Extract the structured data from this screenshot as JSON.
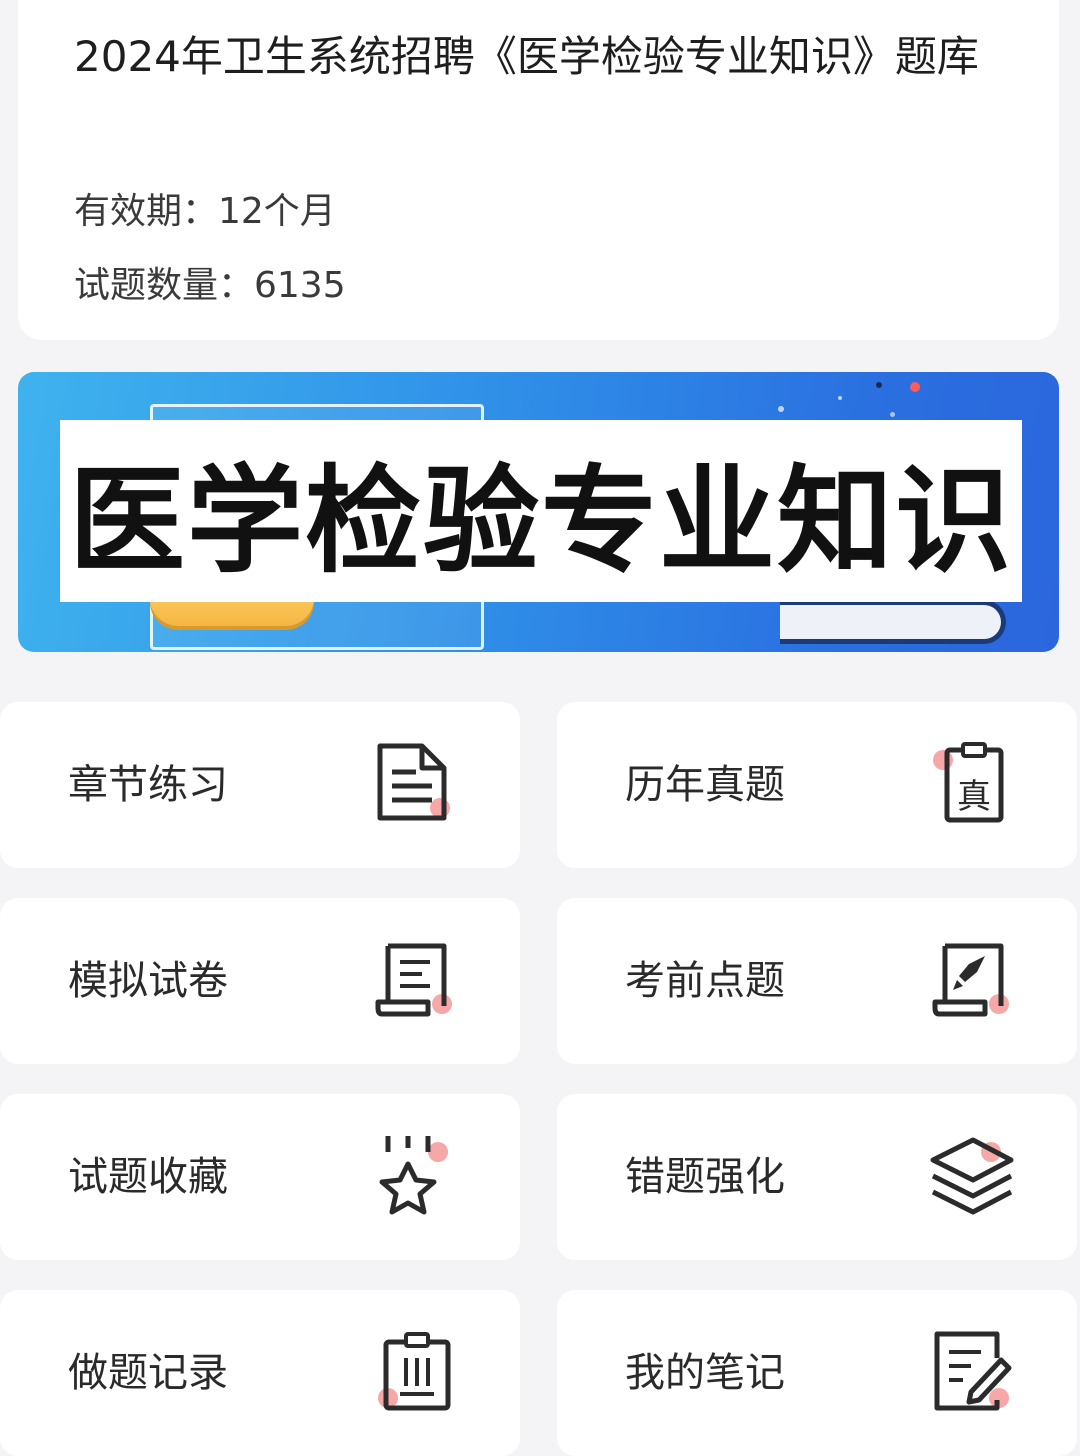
{
  "product": {
    "title": "2024年卫生系统招聘《医学检验专业知识》题库",
    "validity": "有效期：12个月",
    "question_count": "试题数量：6135"
  },
  "banner": {
    "label": "医学检验专业知识"
  },
  "menu": [
    {
      "label": "章节练习",
      "icon": "document-icon"
    },
    {
      "label": "历年真题",
      "icon": "clipboard-zhen-icon"
    },
    {
      "label": "模拟试卷",
      "icon": "scroll-icon"
    },
    {
      "label": "考前点题",
      "icon": "rocket-scroll-icon"
    },
    {
      "label": "试题收藏",
      "icon": "star-icon"
    },
    {
      "label": "错题强化",
      "icon": "layers-icon"
    },
    {
      "label": "做题记录",
      "icon": "clipboard-list-icon"
    },
    {
      "label": "我的笔记",
      "icon": "note-pencil-icon"
    }
  ],
  "colors": {
    "accent_dot": "#f29a9a",
    "icon_stroke": "#2b2b2b",
    "banner_start": "#3fb3ee",
    "banner_end": "#2b66dd"
  }
}
